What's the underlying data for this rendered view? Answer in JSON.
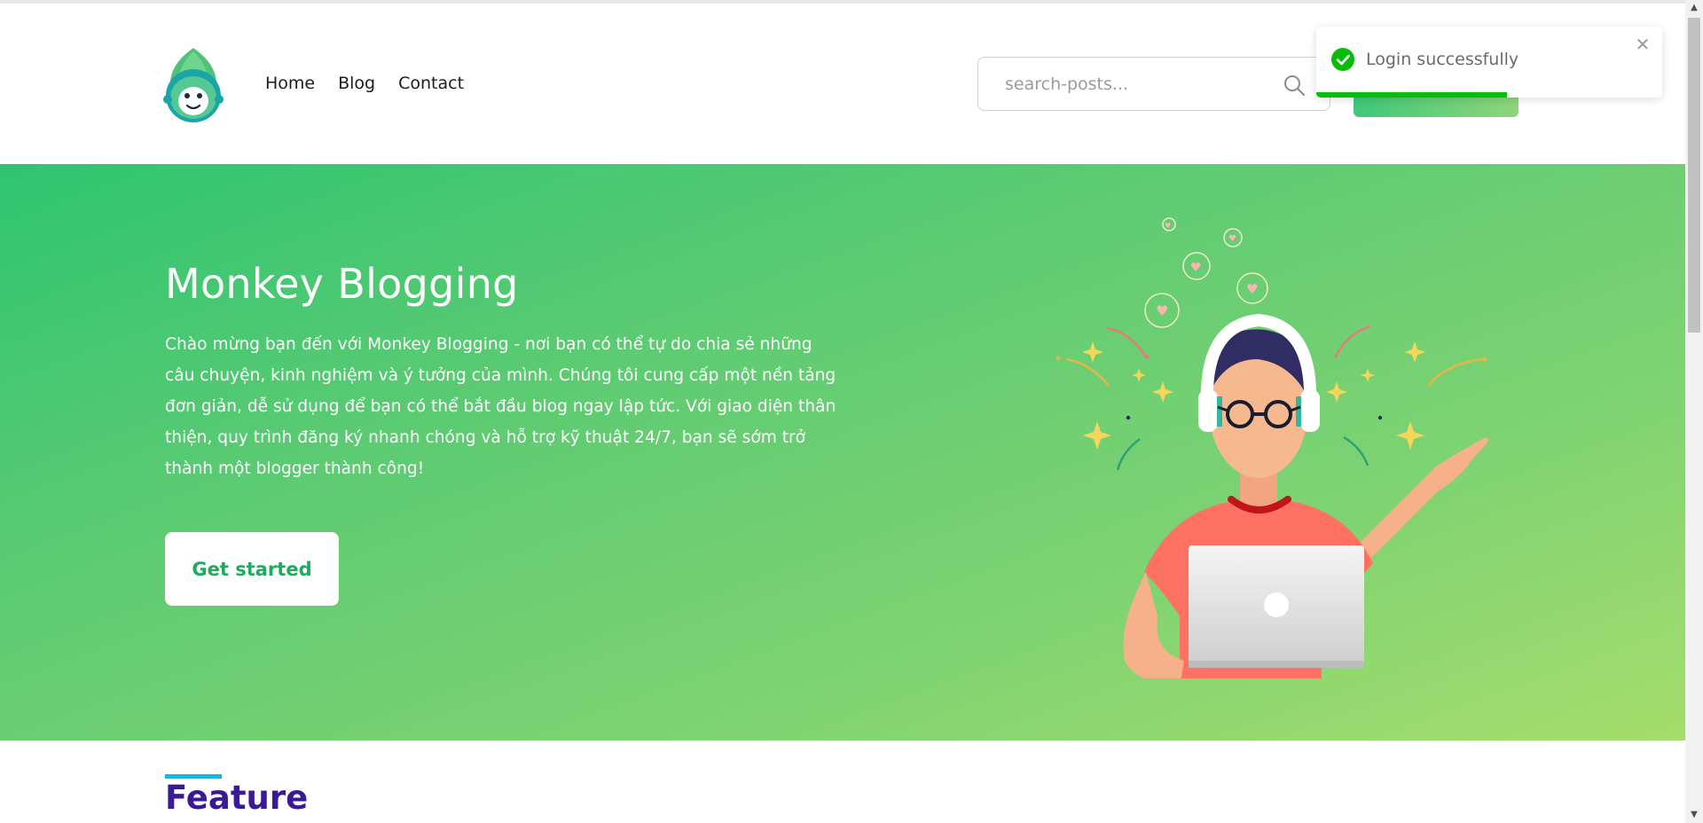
{
  "header": {
    "logo_alt": "Monkey Blogging logo",
    "nav": [
      {
        "label": "Home"
      },
      {
        "label": "Blog"
      },
      {
        "label": "Contact"
      }
    ],
    "search": {
      "placeholder": "search-posts...",
      "value": ""
    },
    "action_button_label": ""
  },
  "toast": {
    "message": "Login successfully",
    "close_icon": "close-icon",
    "status_icon": "check-circle-icon",
    "progress_fraction": 0.55,
    "color": "#07bc0c"
  },
  "hero": {
    "title": "Monkey Blogging",
    "description": "Chào mừng bạn đến với Monkey Blogging - nơi bạn có thể tự do chia sẻ những câu chuyện, kinh nghiệm và ý tưởng của mình. Chúng tôi cung cấp một nền tảng đơn giản, dễ sử dụng để bạn có thể bắt đầu blog ngay lập tức. Với giao diện thân thiện, quy trình đăng ký nhanh chóng và hỗ trợ kỹ thuật 24/7, bạn sẽ sớm trở thành một blogger thành công!",
    "cta_label": "Get started",
    "gradient_start": "#2fc471",
    "gradient_end": "#a6dd6c"
  },
  "feature": {
    "title": "Feature",
    "accent_color": "#00bfe8",
    "title_color": "#3b1a97"
  },
  "scrollbar": {
    "up_icon": "scroll-up-arrow-icon",
    "down_icon": "scroll-down-arrow-icon"
  }
}
